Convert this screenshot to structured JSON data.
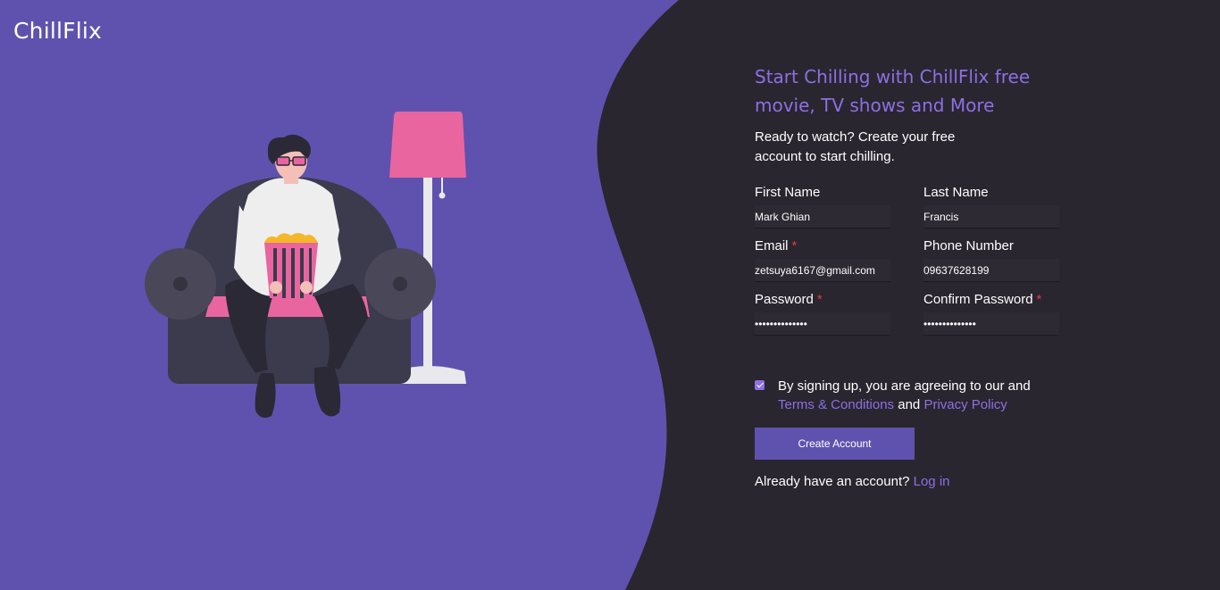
{
  "brand": {
    "name": "ChillFlix"
  },
  "colors": {
    "primary_purple": "#5f52ae",
    "dark_panel": "#29262f",
    "accent": "#8e6fe4",
    "required": "#e23a3a",
    "lamp_pink": "#e9659f"
  },
  "illustration": {
    "subject": "person-on-sofa-with-popcorn-and-lamp"
  },
  "form": {
    "headline": "Start Chilling with ChillFlix free movie, TV shows and More",
    "subtext": "Ready to watch? Create your free account to start chilling.",
    "fields": {
      "first_name": {
        "label": "First Name",
        "value": "Mark Ghian"
      },
      "last_name": {
        "label": "Last Name",
        "value": "Francis"
      },
      "email": {
        "label": "Email",
        "value": "zetsuya6167@gmail.com",
        "required": true
      },
      "phone": {
        "label": "Phone Number",
        "value": "09637628199"
      },
      "password": {
        "label": "Password",
        "value": "••••••••••••••",
        "required": true
      },
      "confirm_password": {
        "label": "Confirm Password",
        "value": "••••••••••••••",
        "required": true
      }
    },
    "required_mark": "*",
    "agreement": {
      "checked": true,
      "text": "By signing up, you are agreeing to our and",
      "terms_link": "Terms & Conditions",
      "and_word": "and",
      "privacy_link": "Privacy Policy"
    },
    "submit_label": "Create Account",
    "login_prompt": "Already have an account?",
    "login_link": "Log in"
  }
}
